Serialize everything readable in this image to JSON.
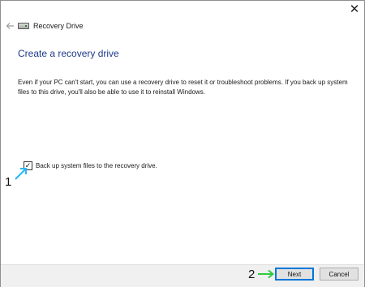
{
  "window": {
    "title": "Recovery Drive",
    "close_glyph": "✕",
    "back_glyph": "←",
    "icon": "recovery-drive-icon"
  },
  "main": {
    "heading": "Create a recovery drive",
    "description": "Even if your PC can't start, you can use a recovery drive to reset it or troubleshoot problems. If you back up system files to this drive, you'll also be able to use it to reinstall Windows.",
    "checkbox": {
      "label": "Back up system files to the recovery drive.",
      "checked": true,
      "check_glyph": "✓"
    }
  },
  "annotations": {
    "step1": "1",
    "step2": "2",
    "step1_arrow_color": "#29b6f6",
    "step2_arrow_color": "#2ecc40"
  },
  "footer": {
    "next_label": "Next",
    "cancel_label": "Cancel"
  },
  "colors": {
    "heading": "#1e3a8a",
    "default_button_border": "#0078d7"
  }
}
